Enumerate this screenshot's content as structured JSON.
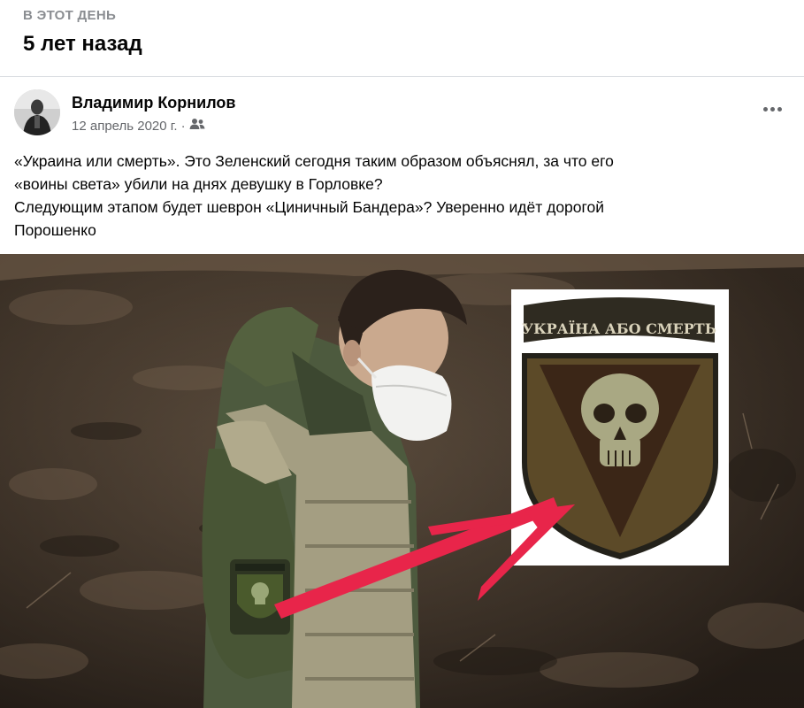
{
  "memory": {
    "kicker": "В ЭТОТ ДЕНЬ",
    "title": "5 лет назад"
  },
  "post": {
    "author": "Владимир Корнилов",
    "date": "12 апрель 2020 г.",
    "separator": "·",
    "audience_icon": "friends-icon",
    "more_icon": "more-options-icon",
    "text_lines": [
      "«Украина или смерть». Это Зеленский сегодня таким образом объяснял, за что его",
      "«воины света» убили на днях девушку в Горловке?",
      "Следующим этапом будет шеврон «Циничный Бандера»? Уверенно идёт дорогой",
      "Порошенко"
    ],
    "image": {
      "patch_banner": "УКРАЇНА АБО СМЕРТЬ",
      "arrow_color": "#e8254a"
    }
  },
  "colors": {
    "secondary_text": "#65676b",
    "kicker_text": "#8a8d91",
    "divider": "#dadde1"
  }
}
